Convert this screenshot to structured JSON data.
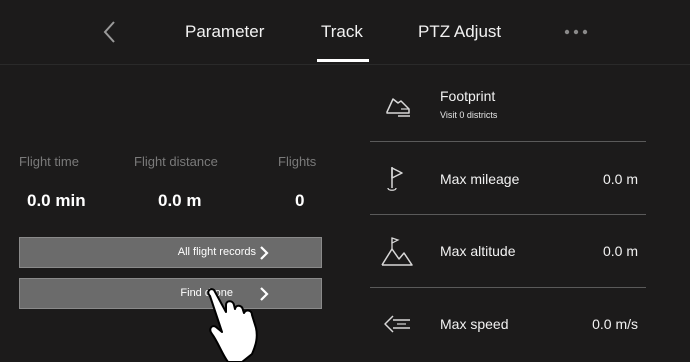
{
  "header": {
    "tabs": [
      "Parameter",
      "Track",
      "PTZ Adjust"
    ],
    "active_tab": "Track",
    "back_icon": "chevron-left-icon",
    "more_icon": "more-horizontal-icon"
  },
  "stats": {
    "flight_time": {
      "label": "Flight time",
      "value": "0.0 min"
    },
    "flight_distance": {
      "label": "Flight distance",
      "value": "0.0 m"
    },
    "flights": {
      "label": "Flights",
      "value": "0"
    }
  },
  "actions": {
    "all_records": "All flight records",
    "find_drone": "Find drone"
  },
  "records": {
    "footprint": {
      "label": "Footprint",
      "sub": "Visit 0 districts",
      "icon": "shoe-icon"
    },
    "max_mileage": {
      "label": "Max mileage",
      "value": "0.0 m",
      "icon": "flag-icon"
    },
    "max_altitude": {
      "label": "Max altitude",
      "value": "0.0 m",
      "icon": "mountain-icon"
    },
    "max_speed": {
      "label": "Max speed",
      "value": "0.0 m/s",
      "icon": "speed-arrow-icon"
    }
  },
  "colors": {
    "background": "#1c1b1b",
    "button": "#6b6b6b",
    "muted_text": "#7a7a7a",
    "text": "#ffffff"
  }
}
